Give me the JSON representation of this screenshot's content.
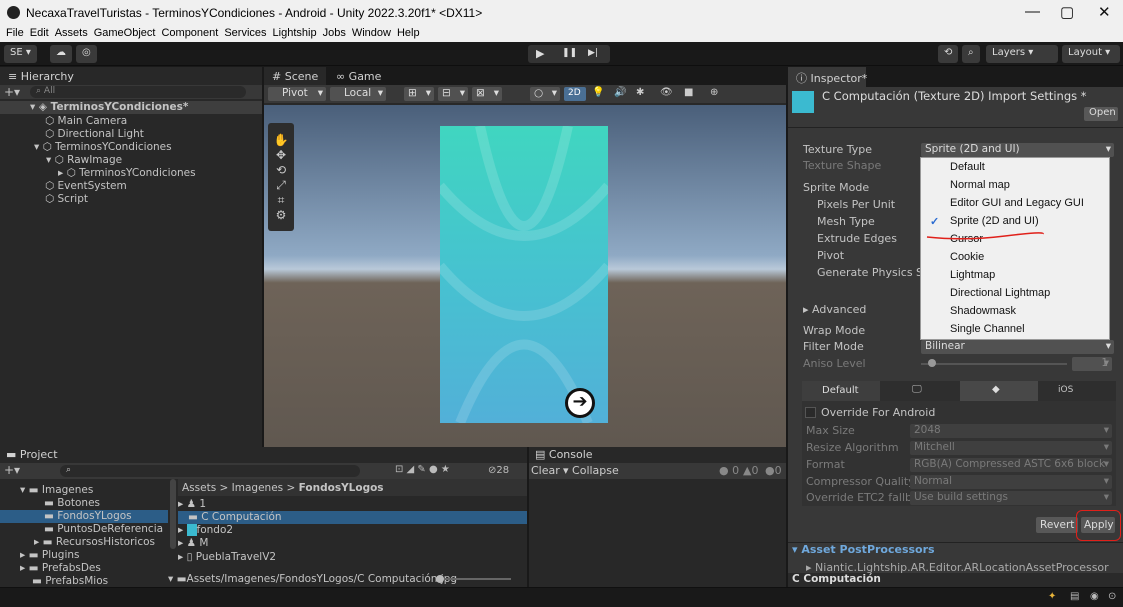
{
  "window": {
    "title": "NecaxaTravelTuristas - TerminosYCondiciones - Android - Unity 2022.3.20f1* <DX11>",
    "min": "—",
    "max": "▢",
    "close": "✕"
  },
  "menu": [
    "File",
    "Edit",
    "Assets",
    "GameObject",
    "Component",
    "Services",
    "Lightship",
    "Jobs",
    "Window",
    "Help"
  ],
  "toolbar": {
    "account": "SE ▾",
    "play": "▶",
    "pause": "❚❚",
    "step": "▶|",
    "layers": "Layers",
    "layout": "Layout"
  },
  "hierarchy": {
    "tab": "Hierarchy",
    "search": "All",
    "scene": "TerminosYCondiciones*",
    "items": [
      "Main Camera",
      "Directional Light",
      "TerminosYCondiciones",
      "RawImage",
      "TerminosYCondiciones",
      "EventSystem",
      "Script"
    ]
  },
  "scene": {
    "tab_scene": "Scene",
    "tab_game": "Game",
    "pivot": "Pivot",
    "local": "Local",
    "mode2d": "2D"
  },
  "inspector": {
    "tab": "Inspector*",
    "title": "C Computación (Texture 2D) Import Settings *",
    "open": "Open",
    "fields": [
      "Texture Type",
      "Texture Shape",
      "Sprite Mode",
      "Pixels Per Unit",
      "Mesh Type",
      "Extrude Edges",
      "Pivot",
      "Generate Physics Sha",
      "Advanced",
      "Wrap Mode",
      "Filter Mode",
      "Aniso Level"
    ],
    "texture_type_value": "Sprite (2D and UI)",
    "filter_value": "Bilinear",
    "aniso_value": "1",
    "platform_tabs": [
      "Default",
      "iOS"
    ],
    "override": "Override For Android",
    "platform_fields": [
      [
        "Max Size",
        "2048"
      ],
      [
        "Resize Algorithm",
        "Mitchell"
      ],
      [
        "Format",
        "RGB(A) Compressed ASTC 6x6 block"
      ],
      [
        "Compressor Quality",
        "Normal"
      ],
      [
        "Override ETC2 fallback",
        "Use build settings"
      ]
    ],
    "revert": "Revert",
    "apply": "Apply",
    "postproc": "Asset PostProcessors",
    "postproc_item": "Niantic.Lightship.AR.Editor.ARLocationAssetProcessor",
    "footer": "C Computación"
  },
  "popup": {
    "options": [
      "Default",
      "Normal map",
      "Editor GUI and Legacy GUI",
      "Sprite (2D and UI)",
      "Cursor",
      "Cookie",
      "Lightmap",
      "Directional Lightmap",
      "Shadowmask",
      "Single Channel"
    ],
    "selected": "✓"
  },
  "project": {
    "tab": "Project",
    "count": "28",
    "tree": [
      "Imagenes",
      "Botones",
      "FondosYLogos",
      "PuntosDeReferencia",
      "RecursosHistoricos",
      "Plugins",
      "PrefabsDes",
      "PrefabsMios"
    ],
    "breadcrumb": [
      "Assets",
      ">",
      "Imagenes",
      ">",
      "FondosYLogos"
    ],
    "files": [
      "1",
      "C Computación",
      "fondo2",
      "M",
      "PueblaTravelV2"
    ],
    "path": "Assets/Imagenes/FondosYLogos/C Computación.jpg"
  },
  "console": {
    "tab": "Console",
    "clear": "Clear",
    "collapse": "Collapse",
    "c1": "0",
    "c2": "0",
    "c3": "0"
  },
  "colors": {
    "accent": "#2c5d87",
    "annotation": "#e0201a"
  }
}
